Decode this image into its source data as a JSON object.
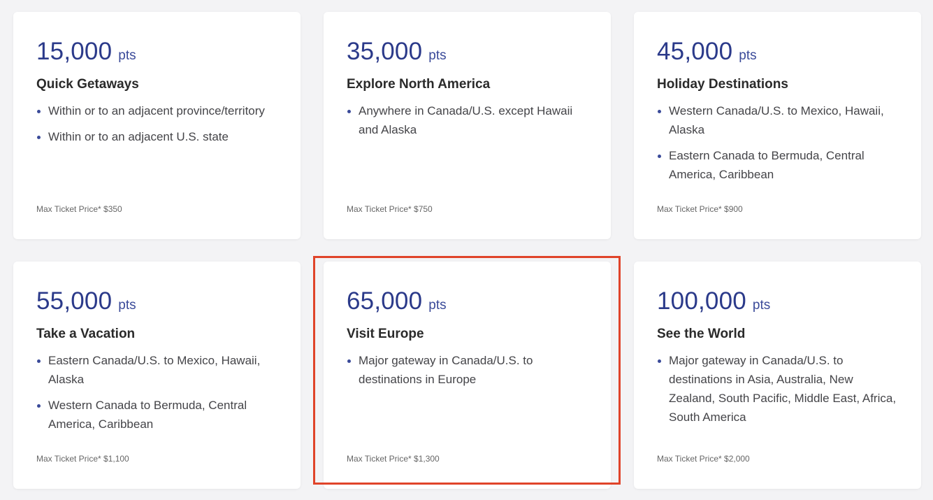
{
  "cards": [
    {
      "points": "15,000",
      "unit": "pts",
      "title": "Quick Getaways",
      "bullets": [
        "Within or to an adjacent province/territory",
        "Within or to an adjacent U.S. state"
      ],
      "max_price": "Max Ticket Price* $350"
    },
    {
      "points": "35,000",
      "unit": "pts",
      "title": "Explore North America",
      "bullets": [
        "Anywhere in Canada/U.S. except Hawaii and Alaska"
      ],
      "max_price": "Max Ticket Price* $750"
    },
    {
      "points": "45,000",
      "unit": "pts",
      "title": "Holiday Destinations",
      "bullets": [
        "Western Canada/U.S. to Mexico, Hawaii, Alaska",
        "Eastern Canada to Bermuda, Central America, Caribbean"
      ],
      "max_price": "Max Ticket Price* $900"
    },
    {
      "points": "55,000",
      "unit": "pts",
      "title": "Take a Vacation",
      "bullets": [
        "Eastern Canada/U.S. to Mexico, Hawaii, Alaska",
        "Western Canada to Bermuda, Central America, Caribbean"
      ],
      "max_price": "Max Ticket Price* $1,100"
    },
    {
      "points": "65,000",
      "unit": "pts",
      "title": "Visit Europe",
      "bullets": [
        "Major gateway in Canada/U.S. to destinations in Europe"
      ],
      "max_price": "Max Ticket Price* $1,300"
    },
    {
      "points": "100,000",
      "unit": "pts",
      "title": "See the World",
      "bullets": [
        "Major gateway in Canada/U.S. to destinations in Asia, Australia, New Zealand, South Pacific, Middle East, Africa, South America"
      ],
      "max_price": "Max Ticket Price* $2,000"
    }
  ],
  "colors": {
    "accent": "#2b3a8a",
    "highlight": "#e0442a",
    "background": "#f3f3f5"
  }
}
